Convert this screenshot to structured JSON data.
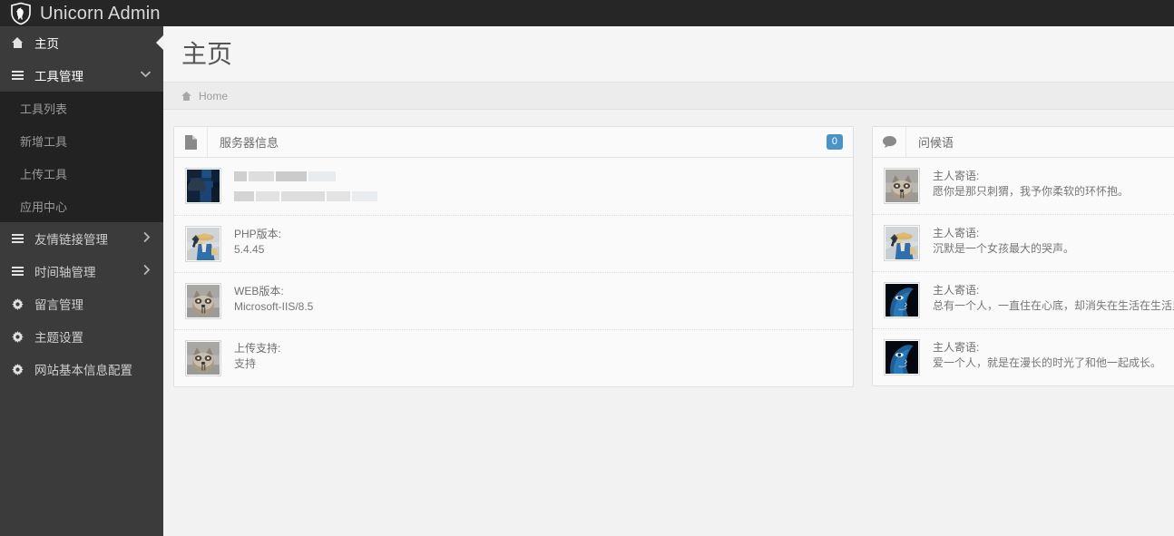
{
  "brand": {
    "title": "Unicorn Admin",
    "logo_icon": "unicorn-shield-icon"
  },
  "sidebar": {
    "items": [
      {
        "label": "主页",
        "icon": "home-icon",
        "active": true,
        "caret": ""
      },
      {
        "label": "工具管理",
        "icon": "list-icon",
        "active": false,
        "caret": "chevron-down-icon"
      },
      {
        "label": "友情链接管理",
        "icon": "list-icon",
        "active": false,
        "caret": "chevron-right-icon"
      },
      {
        "label": "时间轴管理",
        "icon": "list-icon",
        "active": false,
        "caret": "chevron-right-icon"
      },
      {
        "label": "留言管理",
        "icon": "gear-icon",
        "active": false,
        "caret": ""
      },
      {
        "label": "主题设置",
        "icon": "gear-icon",
        "active": false,
        "caret": ""
      },
      {
        "label": "网站基本信息配置",
        "icon": "gear-icon",
        "active": false,
        "caret": ""
      }
    ],
    "submenu": [
      {
        "label": "工具列表"
      },
      {
        "label": "新增工具"
      },
      {
        "label": "上传工具"
      },
      {
        "label": "应用中心"
      }
    ]
  },
  "page": {
    "title": "主页",
    "breadcrumb": {
      "icon": "home-icon",
      "label": "Home"
    }
  },
  "server_panel": {
    "icon": "file-icon",
    "title": "服务器信息",
    "badge": "0",
    "rows": [
      {
        "avatar": "blue-pixel-avatar",
        "key": "",
        "value": "",
        "redacted": true
      },
      {
        "avatar": "detective-avatar",
        "key": "PHP版本:",
        "value": "5.4.45",
        "redacted": false
      },
      {
        "avatar": "raccoon-avatar",
        "key": "WEB版本:",
        "value": "Microsoft-IIS/8.5",
        "redacted": false
      },
      {
        "avatar": "raccoon-avatar",
        "key": "上传支持:",
        "value": "支持",
        "redacted": false
      }
    ]
  },
  "greet_panel": {
    "icon": "comment-icon",
    "title": "问候语",
    "rows": [
      {
        "avatar": "raccoon-avatar",
        "key": "主人寄语:",
        "value": "愿你是那只刺猬，我予你柔软的环怀抱。"
      },
      {
        "avatar": "detective-avatar",
        "key": "主人寄语:",
        "value": "沉默是一个女孩最大的哭声。"
      },
      {
        "avatar": "blue-face-avatar",
        "key": "主人寄语:",
        "value": "总有一个人，一直住在心底，却消失在生活在生活里。"
      },
      {
        "avatar": "blue-face-avatar",
        "key": "主人寄语:",
        "value": "爱一个人，就是在漫长的时光了和他一起成长。"
      }
    ]
  },
  "colors": {
    "topbar": "#262626",
    "sidebar": "#3b3b3b",
    "submenu": "#222222",
    "badge": "#4a93c9",
    "content_bg": "#f2f2f2"
  }
}
